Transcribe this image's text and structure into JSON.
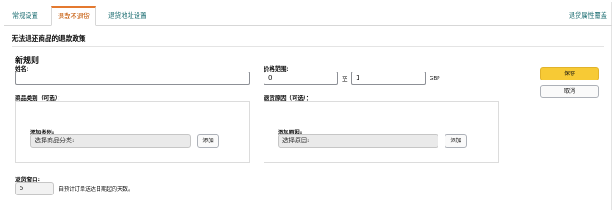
{
  "tabs": [
    {
      "label": "常规设置"
    },
    {
      "label": "退款不退货"
    },
    {
      "label": "退货地址设置"
    }
  ],
  "header_link": "退货属性覆盖",
  "section_title": "无法退还商品的退款政策",
  "new_rule": {
    "heading": "新规则",
    "name_label": "姓名:",
    "name_value": "",
    "price_range_label": "价格范围:",
    "price_min": "0",
    "price_to": "至",
    "price_max": "1",
    "currency": "GBP"
  },
  "category": {
    "label": "商品类别（可选）：",
    "add_label": "添加类别:",
    "placeholder": "选择商品分类:",
    "add_button": "添加"
  },
  "reason": {
    "label": "退货原因（可选）：",
    "add_label": "添加原因:",
    "placeholder": "选择原因:",
    "add_button": "添加"
  },
  "return_window": {
    "label": "退货窗口:",
    "value": "5",
    "description": "自预计订单送达日期起的天数。"
  },
  "actions": {
    "save": "保存",
    "cancel": "取消"
  },
  "colors": {
    "accent": "#e4792f",
    "link": "#1e6f73",
    "primary_button": "#f7ca35"
  }
}
